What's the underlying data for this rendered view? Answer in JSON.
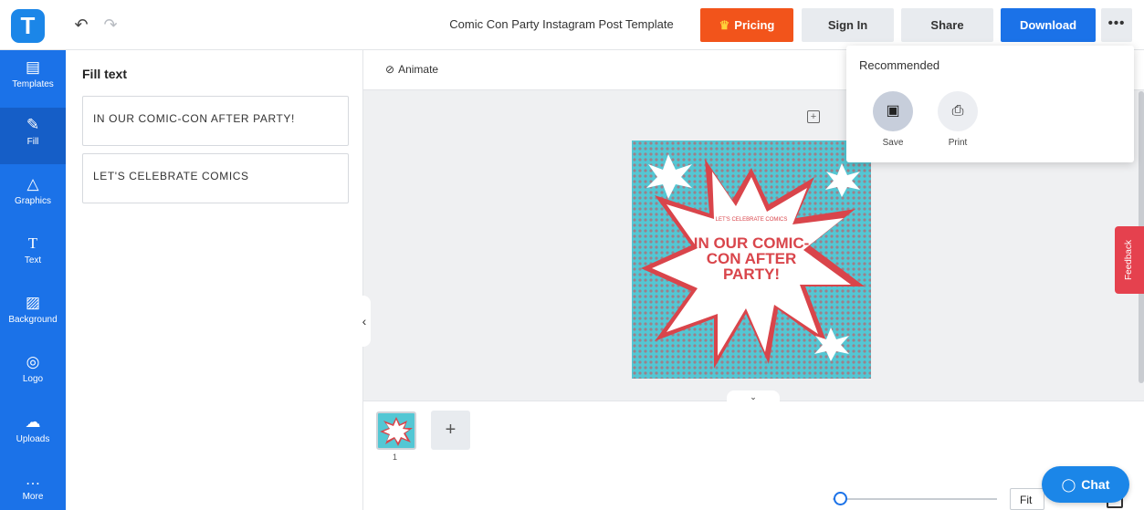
{
  "header": {
    "logo_letter": "T",
    "undo_icon": "undo-icon",
    "redo_icon": "redo-icon",
    "document_title": "Comic Con Party Instagram Post Template",
    "pricing_label": "Pricing",
    "signin_label": "Sign In",
    "share_label": "Share",
    "download_label": "Download",
    "more_label": "•••"
  },
  "sidebar": {
    "items": [
      {
        "label": "Templates",
        "icon": "templates-icon"
      },
      {
        "label": "Fill",
        "icon": "pencil-icon"
      },
      {
        "label": "Graphics",
        "icon": "shapes-icon"
      },
      {
        "label": "Text",
        "icon": "text-icon"
      },
      {
        "label": "Background",
        "icon": "background-icon"
      },
      {
        "label": "Logo",
        "icon": "logo-icon"
      },
      {
        "label": "Uploads",
        "icon": "upload-icon"
      },
      {
        "label": "More",
        "icon": "more-icon"
      }
    ],
    "active_index": 1
  },
  "panel": {
    "title": "Fill text",
    "fields": [
      "IN OUR COMIC-CON AFTER PARTY!",
      "LET'S CELEBRATE COMICS"
    ]
  },
  "toolbar": {
    "animate_label": "Animate"
  },
  "artboard": {
    "small_text": "LET'S CELEBRATE COMICS",
    "big_text": "IN OUR COMIC-CON AFTER PARTY!",
    "colors": {
      "background": "#53c7d4",
      "accent": "#d9454b"
    }
  },
  "dropdown": {
    "title": "Recommended",
    "items": [
      {
        "label": "Save",
        "icon": "save-icon"
      },
      {
        "label": "Print",
        "icon": "print-icon"
      }
    ]
  },
  "feedback_label": "Feedback",
  "pages": {
    "current_page": "1"
  },
  "zoom": {
    "fit_label": "Fit"
  },
  "chat_label": "Chat",
  "theme": {
    "primary": "#1b72e8",
    "pricing": "#f2541b",
    "feedback": "#e5414e"
  }
}
